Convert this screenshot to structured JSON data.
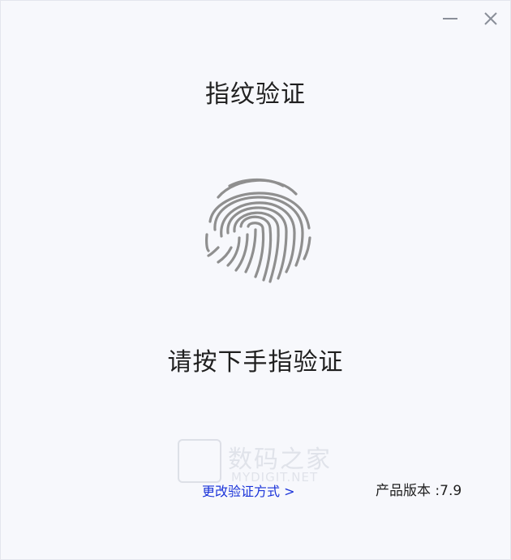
{
  "window": {
    "title": "指纹验证",
    "controls": [
      "minimize-icon",
      "close-icon"
    ]
  },
  "main": {
    "icon": "fingerprint-icon",
    "prompt": "请按下手指验证"
  },
  "footer": {
    "change_method": "更改验证方式 >",
    "version": "产品版本 :7.9"
  },
  "watermark": {
    "cn": "数码之家",
    "en": "MYDIGIT.NET"
  },
  "colors": {
    "background": "#f7f8fc",
    "link": "#1a33d9",
    "fingerprint": "#8f8f8f"
  }
}
